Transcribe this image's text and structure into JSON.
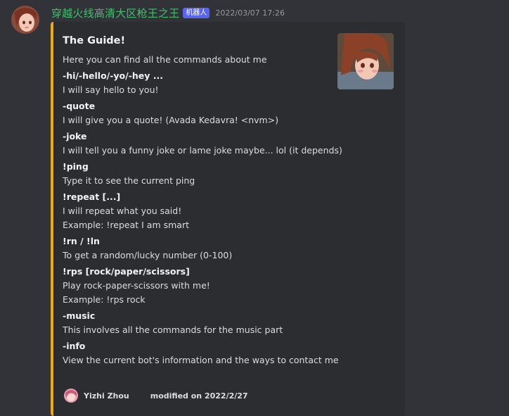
{
  "message": {
    "username": "穿越火线高清大区枪王之王",
    "bot_tag": "机器人",
    "timestamp": "2022/03/07 17:26",
    "accent_color": "#f0a61a"
  },
  "embed": {
    "title": "The Guide!",
    "description": "Here you can find all the commands about me",
    "fields": [
      {
        "name": "-hi/-hello/-yo/-hey ...",
        "lines": [
          "I will say hello to you!"
        ]
      },
      {
        "name": "-quote",
        "lines": [
          "I will give you a quote! (Avada Kedavra! <nvm>)"
        ]
      },
      {
        "name": "-joke",
        "lines": [
          "I will tell you a funny joke or lame joke maybe... lol (it depends)"
        ]
      },
      {
        "name": "!ping",
        "lines": [
          "Type it to see the current ping"
        ]
      },
      {
        "name": "!repeat [...]",
        "lines": [
          "I will repeat what you said!",
          "Example: !repeat I am smart"
        ]
      },
      {
        "name": "!rn / !ln",
        "lines": [
          "To get a random/lucky number (0-100)"
        ]
      },
      {
        "name": "!rps [rock/paper/scissors]",
        "lines": [
          "Play rock-paper-scissors with me!",
          "Example: !rps rock"
        ]
      },
      {
        "name": "-music",
        "lines": [
          "This involves all the commands for the music part"
        ]
      },
      {
        "name": "-info",
        "lines": [
          "View the current bot's information and the ways to contact me"
        ]
      }
    ],
    "footer": {
      "author": "Yizhi Zhou",
      "text": "modified on 2022/2/27"
    }
  }
}
